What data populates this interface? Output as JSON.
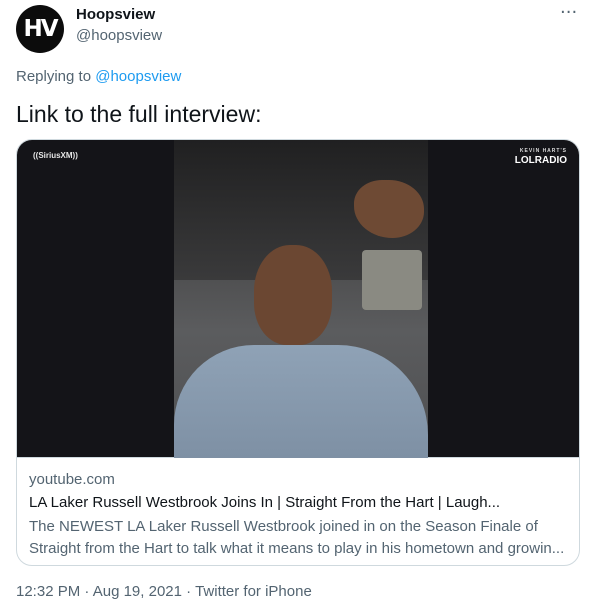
{
  "author": {
    "avatar_text": "HV",
    "name": "Hoopsview",
    "handle": "@hoopsview",
    "more_icon": "more-horizontal-icon"
  },
  "reply": {
    "prefix": "Replying to",
    "mention": "@hoopsview"
  },
  "tweet": {
    "text": "Link to the full interview:"
  },
  "card": {
    "media_labels": {
      "sirius": "((SiriusXM))",
      "lol_kicker": "KEVIN HART'S",
      "lol_radio": "LOLRADIO"
    },
    "domain": "youtube.com",
    "title": "LA Laker Russell Westbrook Joins In | Straight From the Hart | Laugh...",
    "description": "The NEWEST LA Laker Russell Westbrook joined in on the Season Finale of Straight from the Hart to talk what it means to play in his hometown and growin..."
  },
  "meta": {
    "time": "12:32 PM",
    "date": "Aug 19, 2021",
    "source": "Twitter for iPhone",
    "separator": "·"
  },
  "colors": {
    "text": "#0f1419",
    "secondary": "#536471",
    "link": "#1d9bf0",
    "border": "#cfd9de"
  }
}
